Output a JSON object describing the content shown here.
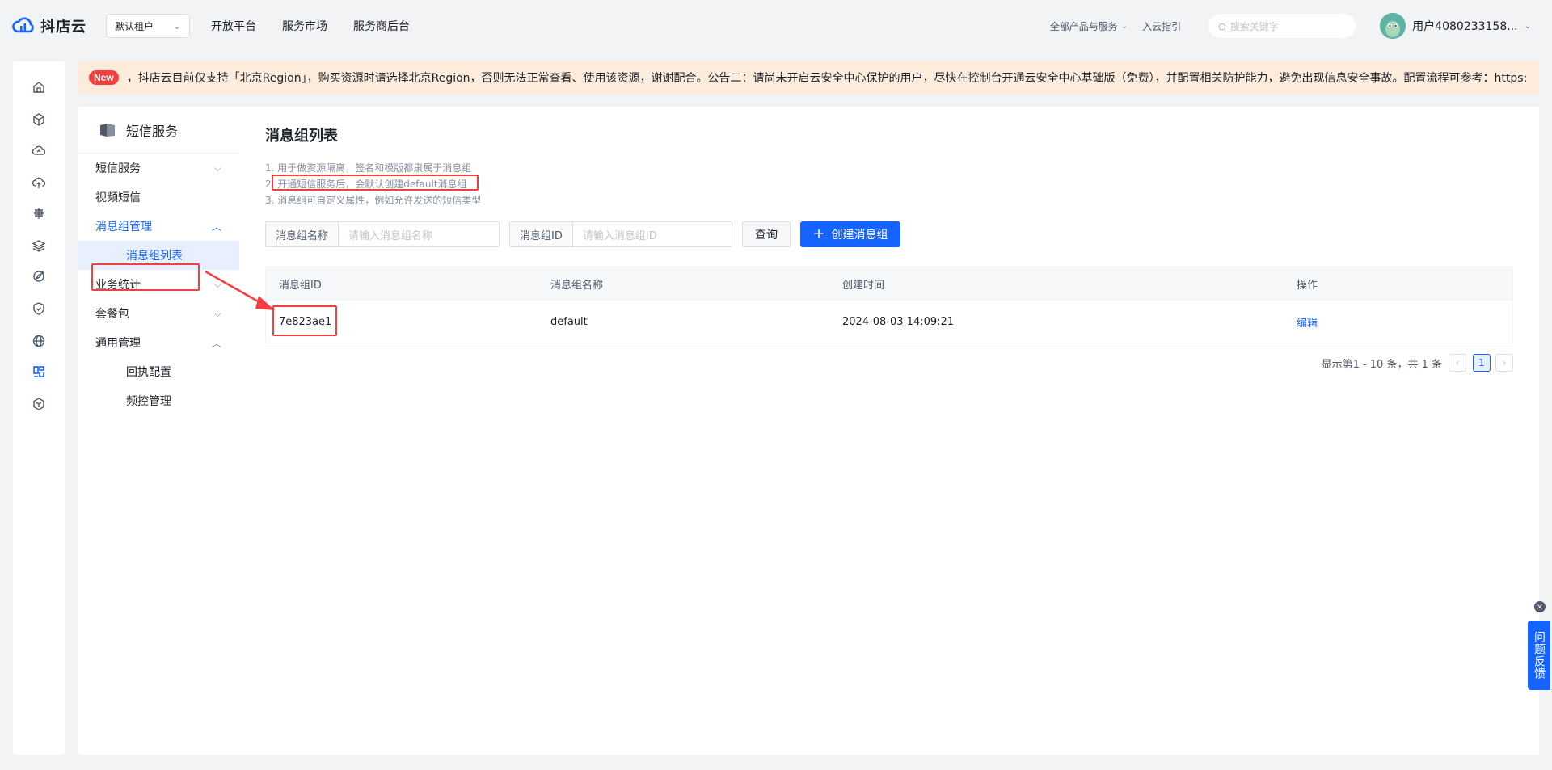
{
  "brand": {
    "name": "抖店云"
  },
  "tenant": {
    "label": "默认租户"
  },
  "topnav": [
    {
      "label": "开放平台"
    },
    {
      "label": "服务市场"
    },
    {
      "label": "服务商后台"
    }
  ],
  "topright": {
    "products": "全部产品与服务",
    "guide": "入云指引",
    "search_placeholder": "搜索关键字",
    "username": "用户4080233158..."
  },
  "rail_icons": [
    "home-icon",
    "cube-icon",
    "cloud-icon",
    "cloud-upload-icon",
    "server-icon",
    "layers-icon",
    "compass-icon",
    "shield-icon",
    "globe-icon",
    "sms-icon",
    "box-icon"
  ],
  "notice": {
    "badge": "New",
    "text": "，抖店云目前仅支持「北京Region」，购买资源时请选择北京Region，否则无法正常查看、使用该资源，谢谢配合。公告二：请尚未开启云安全中心保护的用户，尽快在控制台开通云安全中心基础版（免费），并配置相关防护能力，避免出现信息安全事故。配置流程可参考：https:"
  },
  "sidebar": {
    "title": "短信服务",
    "items": [
      {
        "label": "短信服务"
      },
      {
        "label": "视频短信"
      },
      {
        "label": "消息组管理"
      },
      {
        "label": "消息组列表"
      },
      {
        "label": "业务统计"
      },
      {
        "label": "套餐包"
      },
      {
        "label": "通用管理"
      },
      {
        "label": "回执配置"
      },
      {
        "label": "频控管理"
      }
    ]
  },
  "main": {
    "title": "消息组列表",
    "tips": [
      "1. 用于做资源隔离，签名和模版都隶属于消息组",
      "2. 开通短信服务后，会默认创建default消息组",
      "3. 消息组可自定义属性，例如允许发送的短信类型"
    ],
    "filters": {
      "name_label": "消息组名称",
      "name_placeholder": "请输入消息组名称",
      "id_label": "消息组ID",
      "id_placeholder": "请输入消息组ID"
    },
    "query_button": "查询",
    "create_button": "创建消息组",
    "table": {
      "headers": [
        "消息组ID",
        "消息组名称",
        "创建时间",
        "操作"
      ],
      "rows": [
        {
          "id": "7e823ae1",
          "name": "default",
          "created": "2024-08-03 14:09:21",
          "action": "编辑"
        }
      ]
    },
    "pagination": {
      "summary": "显示第1 - 10 条，共 1 条",
      "current": "1"
    }
  },
  "feedback": {
    "label": "问题反馈"
  },
  "colors": {
    "primary": "#1664ff",
    "annotation": "#f53f3f",
    "notice_bg": "#fdecdb"
  }
}
